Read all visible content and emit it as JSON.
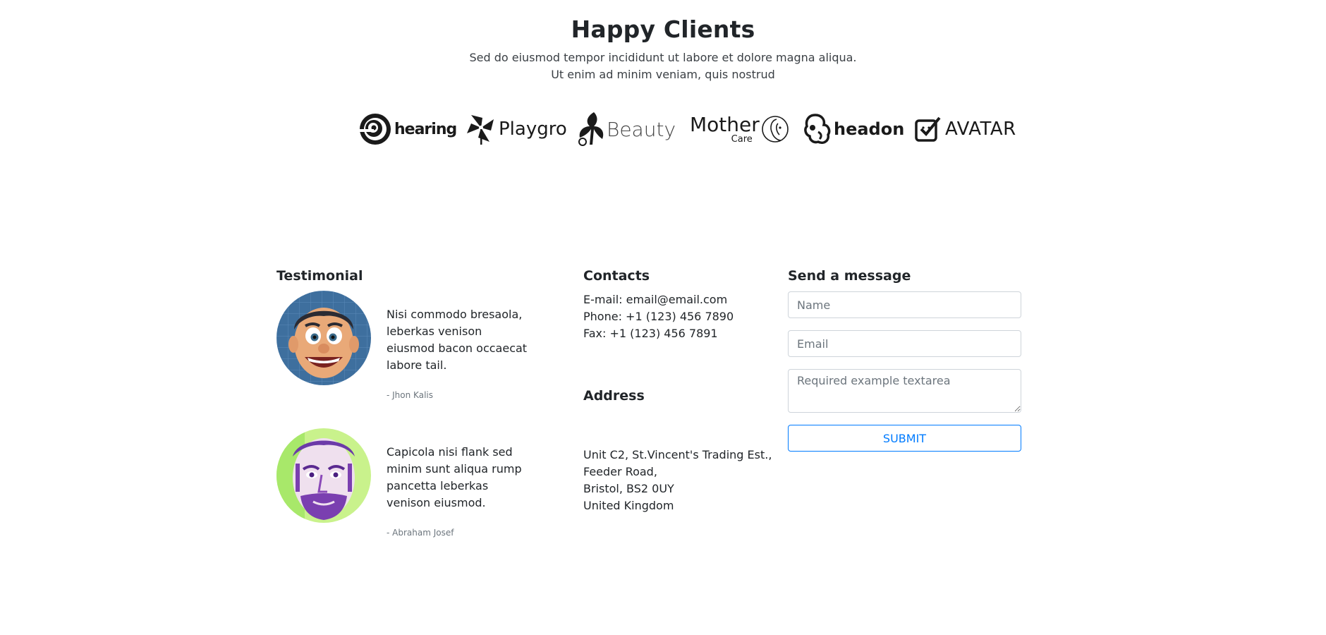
{
  "clients": {
    "title": "Happy Clients",
    "subtitle_line1": "Sed do eiusmod tempor incididunt ut labore et dolore magna aliqua.",
    "subtitle_line2": "Ut enim ad minim veniam, quis nostrud",
    "logos": [
      {
        "name": "hearing",
        "icon": "spiral-icon"
      },
      {
        "name": "Playgro",
        "icon": "pinwheel-icon"
      },
      {
        "name": "Beauty",
        "icon": "butterfly-woman-icon"
      },
      {
        "name": "Mother",
        "sub": "Care",
        "icon": "mother-face-icon"
      },
      {
        "name": "headon",
        "icon": "head-profile-icon"
      },
      {
        "name": "AVATAR",
        "icon": "checkbox-icon"
      }
    ]
  },
  "testimonial": {
    "heading": "Testimonial",
    "items": [
      {
        "quote": "Nisi commodo bresaola, leberkas venison eiusmod bacon occaecat labore tail.",
        "author": "- Jhon Kalis",
        "avatar": "cartoon-man-avatar"
      },
      {
        "quote": "Capicola nisi flank sed minim sunt aliqua rump pancetta leberkas venison eiusmod.",
        "author": "- Abraham Josef",
        "avatar": "bearded-man-avatar"
      }
    ]
  },
  "contacts": {
    "heading": "Contacts",
    "email": "E-mail: email@email.com",
    "phone": "Phone: +1 (123) 456 7890",
    "fax": "Fax: +1 (123) 456 7891"
  },
  "address": {
    "heading": "Address",
    "line1": "Unit C2, St.Vincent's Trading Est.,",
    "line2": "Feeder Road,",
    "line3": "Bristol, BS2 0UY",
    "line4": "United Kingdom"
  },
  "message": {
    "heading": "Send a message",
    "name_placeholder": "Name",
    "email_placeholder": "Email",
    "textarea_placeholder": "Required example textarea",
    "submit_label": "Submit"
  },
  "colors": {
    "accent": "#007bff",
    "text": "#212529",
    "muted": "#6c757d",
    "border": "#ced4da"
  }
}
